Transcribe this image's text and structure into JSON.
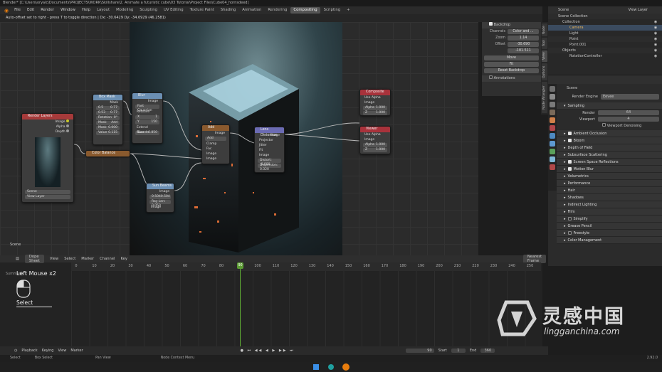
{
  "window": {
    "title": "Blender* [C:\\Users\\oryalc\\Documents\\PROJECTS\\WORK\\Skillshare\\2. Animate a futuristic cube\\03 Tutorial\\Project Files\\Cube04_hornsdeed]"
  },
  "topbar": {
    "menus": [
      "File",
      "Edit",
      "Render",
      "Window",
      "Help"
    ],
    "workspaces": [
      "Layout",
      "Modeling",
      "Sculpting",
      "UV Editing",
      "Texture Paint",
      "Shading",
      "Animation",
      "Rendering",
      "Compositing",
      "Scripting"
    ],
    "active_workspace": "Compositing",
    "add_tab": "+"
  },
  "header_hint": "Auto-offset set to right - press T to toggle direction  |  Dx: -30.6429   Dy: -34.6929 (46.2581)",
  "node_editor": {
    "scene_label": "Scene",
    "nodes": {
      "render_layers": {
        "title": "Render Layers",
        "outputs": [
          "Image",
          "Alpha",
          "Depth"
        ],
        "scene": "Scene",
        "layer": "View Layer"
      },
      "box_mask": {
        "title": "Box Mask",
        "out": "Mask",
        "rows": [
          [
            "X",
            "0.5",
            "0.77"
          ],
          [
            "Y",
            "0.53",
            "0.77"
          ]
        ],
        "width_lbl": "Width",
        "width": "1.9",
        "height_lbl": "Height",
        "height": "1.03",
        "rot_lbl": "Rotation",
        "rot": "0°",
        "mask_lbl": "Mask",
        "mask_val": "Add",
        "val_lbl": "Value",
        "value": "0.000",
        "val2": "0.115"
      },
      "blur": {
        "title": "Blur",
        "out": "Image",
        "type": "Fast Gaussian",
        "relative": "Relative",
        "x": "1",
        "y": "150",
        "extend": "Extend Bounds",
        "image_in": "Image",
        "size_lbl": "Size",
        "size": "0.850"
      },
      "color_balance": {
        "title": "Color Balance"
      },
      "add": {
        "title": "Add",
        "out": "Image",
        "mode": "Add",
        "clamp": "Clamp",
        "fac": "Fac",
        "in1": "Image",
        "in2": "Image"
      },
      "lens_distortion": {
        "title": "Lens Distortion",
        "out": "Image",
        "projector": "Projector",
        "jitter": "Jitter",
        "fit": "Fit",
        "image_in": "Image",
        "distort": "Distort: -0.000",
        "dispersion": "Dispersion: 0.020"
      },
      "sun_beams": {
        "title": "Sun Beams",
        "out": "Image",
        "src": "0.504",
        "src2": "0.504",
        "ray_len": "Ray Len: 0.050",
        "image_in": "Image"
      },
      "composite": {
        "title": "Composite",
        "alpha": "Use Alpha",
        "image": "Image",
        "alpha_lbl": "Alpha",
        "alpha_val": "1.000",
        "z": "Z",
        "z_val": "1.000"
      },
      "viewer": {
        "title": "Viewer",
        "alpha": "Use Alpha",
        "image": "Image",
        "alpha_lbl": "Alpha",
        "alpha_val": "1.000",
        "z": "Z",
        "z_val": "1.000"
      }
    }
  },
  "npanel": {
    "backdrop": "Backdrop",
    "channels_lbl": "Channels",
    "channels": "Color and ...",
    "zoom_lbl": "Zoom",
    "zoom": "1.14",
    "offset_lbl": "Offset",
    "offset_x": "-30.690",
    "offset_y": "-181.511",
    "move": "Move",
    "fit": "Fit",
    "reset": "Reset Backdrop",
    "annotations": "Annotations"
  },
  "side_tabs": [
    "Node",
    "Tool",
    "View",
    "Options",
    "Node Wrangler"
  ],
  "outliner": {
    "header": "Scene",
    "view_layer": "View Layer",
    "items": [
      "Scene Collection",
      "Collection",
      "Camera",
      "Light",
      "Point",
      "Point.001",
      "Objects",
      "RotationController"
    ]
  },
  "properties": {
    "header": "Scene",
    "engine_lbl": "Render Engine",
    "engine": "Eevee",
    "sampling": "Sampling",
    "render_lbl": "Render",
    "render": "64",
    "viewport_lbl": "Viewport",
    "viewport": "4",
    "denoise": "Viewport Denoising",
    "sections": [
      "Ambient Occlusion",
      "Bloom",
      "Depth of Field",
      "Subsurface Scattering",
      "Screen Space Reflections",
      "Motion Blur",
      "Volumetrics",
      "Performance",
      "Hair",
      "Shadows",
      "Indirect Lighting",
      "Film",
      "Simplify",
      "Grease Pencil",
      "Freestyle",
      "Color Management"
    ],
    "checked": [
      true,
      true,
      false,
      false,
      true,
      true,
      false,
      false,
      false,
      false,
      false,
      false,
      false,
      false,
      false,
      false
    ],
    "has_checkbox": [
      true,
      true,
      false,
      false,
      true,
      true,
      false,
      false,
      false,
      false,
      false,
      false,
      true,
      false,
      true,
      false
    ]
  },
  "dopesheet": {
    "mode": "Dope Sheet",
    "menus": [
      "View",
      "Select",
      "Marker",
      "Channel",
      "Key"
    ],
    "summary": "Summary",
    "snap": "Nearest Frame",
    "frames": [
      "0",
      "10",
      "20",
      "30",
      "40",
      "50",
      "60",
      "70",
      "80",
      "90",
      "100",
      "110",
      "120",
      "130",
      "140",
      "150",
      "160",
      "170",
      "180",
      "190",
      "200",
      "210",
      "220",
      "230",
      "240",
      "250"
    ],
    "current": "90",
    "mouse_label": "Left Mouse x2",
    "mouse_action": "Select"
  },
  "timeline": {
    "menus": [
      "Playback",
      "Keying",
      "View",
      "Marker"
    ],
    "frame": "90",
    "start_lbl": "Start",
    "start": "1",
    "end_lbl": "End",
    "end": "360"
  },
  "statusbar": {
    "items": [
      "Select",
      "Box Select",
      "Pan View",
      "Node Context Menu"
    ],
    "version": "2.92.0"
  },
  "watermark": {
    "title": "灵感中国",
    "url": "lingganchina.com"
  },
  "colors": {
    "accent": "#5fae35",
    "active_tab": "#545454",
    "node_converter": "#6b8fb3",
    "node_output": "#a8323b",
    "node_input": "#b33a3a",
    "socket_yellow": "#c7c729"
  }
}
